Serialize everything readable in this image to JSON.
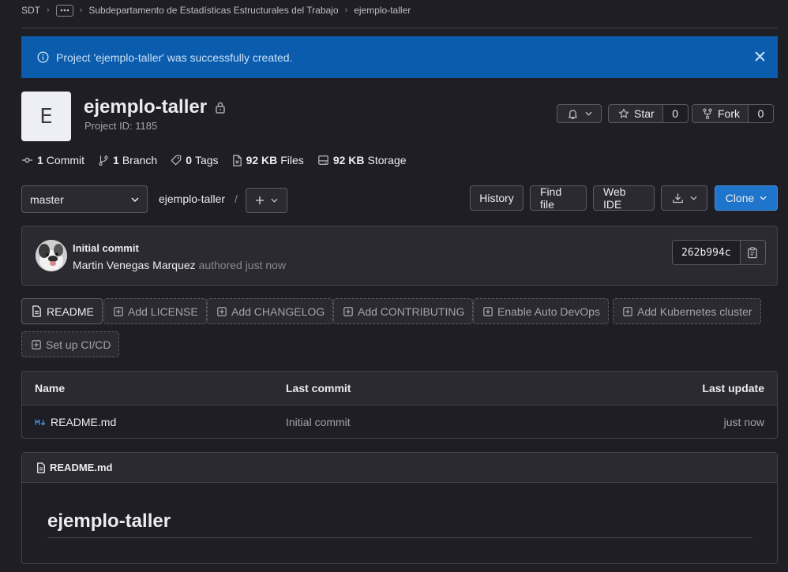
{
  "breadcrumb": {
    "root": "SDT",
    "group": "Subdepartamento de Estadísticas Estructurales del Trabajo",
    "project": "ejemplo-taller"
  },
  "alert": {
    "message": "Project 'ejemplo-taller' was successfully created.",
    "color": "#0b5cad"
  },
  "project": {
    "avatar_letter": "E",
    "name": "ejemplo-taller",
    "id_label": "Project ID: 1185",
    "star_label": "Star",
    "star_count": "0",
    "fork_label": "Fork",
    "fork_count": "0"
  },
  "stats": [
    {
      "icon": "commit-icon",
      "value": "1",
      "label": "Commit"
    },
    {
      "icon": "branch-icon",
      "value": "1",
      "label": "Branch"
    },
    {
      "icon": "tag-icon",
      "value": "0",
      "label": "Tags"
    },
    {
      "icon": "file-icon",
      "value": "92 KB",
      "label": "Files"
    },
    {
      "icon": "storage-icon",
      "value": "92 KB",
      "label": "Storage"
    }
  ],
  "toolbar": {
    "branch": "master",
    "path": "ejemplo-taller",
    "path_sep": "/",
    "history": "History",
    "find_file": "Find file",
    "web_ide": "Web IDE",
    "clone": "Clone"
  },
  "commit": {
    "title": "Initial commit",
    "author": "Martin Venegas Marquez",
    "authored": "authored just now",
    "sha": "262b994c"
  },
  "actions": {
    "readme": "README",
    "license": "Add LICENSE",
    "changelog": "Add CHANGELOG",
    "contributing": "Add CONTRIBUTING",
    "devops": "Enable Auto DevOps",
    "kubernetes": "Add Kubernetes cluster",
    "cicd": "Set up CI/CD"
  },
  "files": {
    "headers": {
      "name": "Name",
      "last_commit": "Last commit",
      "last_update": "Last update"
    },
    "rows": [
      {
        "icon": "markdown-icon",
        "name": "README.md",
        "last_commit": "Initial commit",
        "last_update": "just now"
      }
    ]
  },
  "readme": {
    "filename": "README.md",
    "heading": "ejemplo-taller"
  },
  "colors": {
    "background": "#1f1e24",
    "panel": "#2b2a30",
    "accent": "#1f75cb",
    "border": "#434248"
  }
}
